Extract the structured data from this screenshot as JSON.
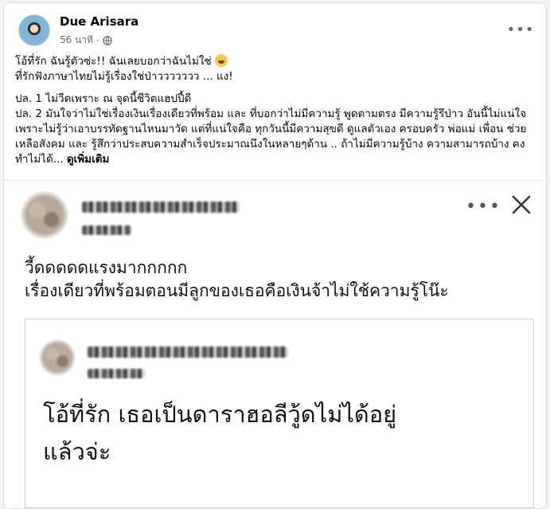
{
  "post": {
    "author": "Due Arisara",
    "time": "56 นาที",
    "line1": "โอ้ที่รัก ฉันรู้ตัวซ่ะ!! ฉันเลยบอกว่าฉันไม่ใช่",
    "line2": "ที่รักฟังภาษาไทยไม่รู้เรื่องใช่ป่าววววววว ... แง!",
    "para1": "ปล. 1 ไม่วีดเพราะ ณ จุดนี้ชีวิตแฮปปี้ดี",
    "para2": "ปล. 2 มันใจว่าไม่ใช่เรื่องเงินเรื่องเดียวที่พร้อม และ ที่บอกว่าไม่มีความรู้ พูดตามตรง มีความรู้รึป่าว อันนี้ไม่แน่ใจ เพราะไม่รู้ว่าเอาบรรทัดฐานไหนมาวัด แต่ที่แน่ใจคือ ทุกวันนี้มีความสุขดี ดูแลตัวเอง ครอบครัว พ่อแม่ เพื่อน ช่วยเหลือสังคม และ รู้สึกว่าประสบความสำเร็จประมาณนึงในหลายๆด้าน .. ถ้าไม่มีความรู้บ้าง ความสามารถบ้าง คงทำไม่ได้...",
    "see_more": "ดูเพิ่มเติม",
    "icons": {
      "more": "more-dots-icon",
      "audience": "globe-icon",
      "emoji": "laughing-emoji-icon"
    }
  },
  "screenshot": {
    "comment_line1": "วี้ดดดดดแรงมากกกกก",
    "comment_line2": "เรื่องเดียวที่พร้อมตอนมีลูกของเธอคือเงินจ้าไม่ใช้ความรู้โน๊ะ",
    "quote_line1": "โอ้ที่รัก เธอเป็นดาราฮอลีวู้ดไม่ได้อยู่",
    "quote_line2": "แล้วจ่ะ",
    "icons": {
      "more": "more-dots-icon",
      "close": "close-icon"
    }
  },
  "colors": {
    "text": "#050505",
    "secondary": "#65676b",
    "border": "#dddfe2",
    "background": "#f0f2f5"
  }
}
